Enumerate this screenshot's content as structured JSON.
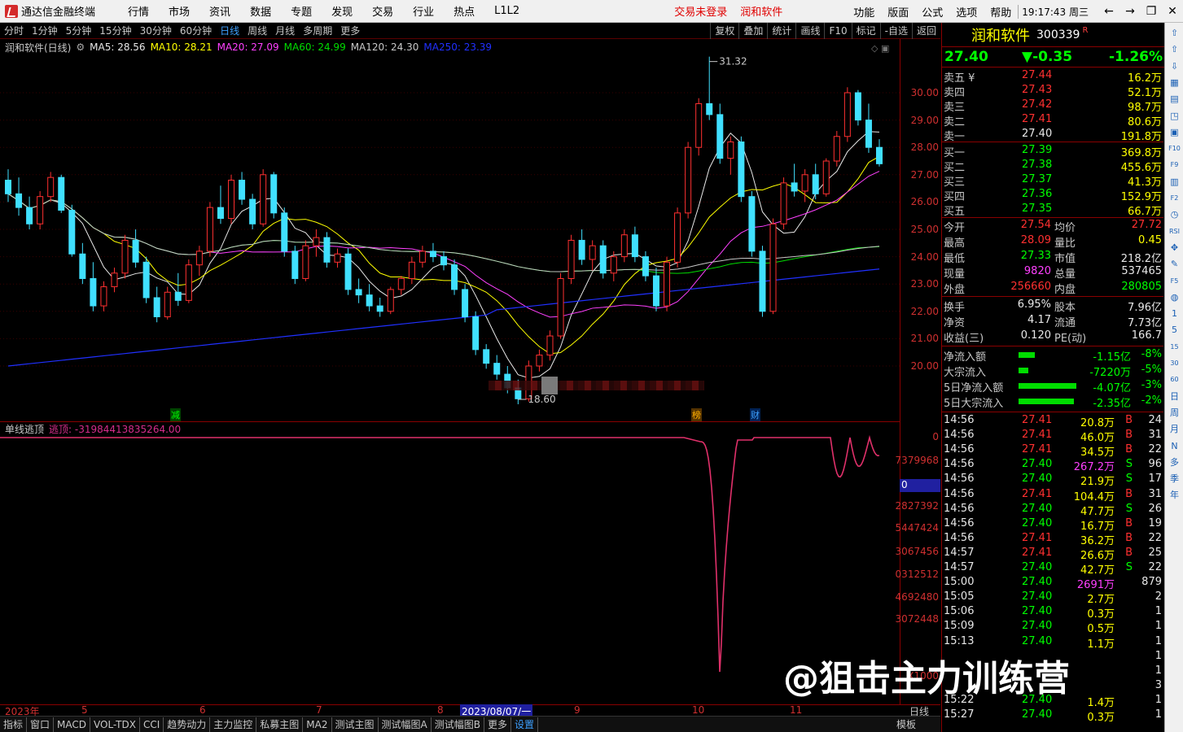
{
  "app": {
    "title": "通达信金融终端"
  },
  "menu": {
    "items": [
      "行情",
      "市场",
      "资讯",
      "数据",
      "专题",
      "发现",
      "交易",
      "行业",
      "热点",
      "L1L2"
    ],
    "login_warn": "交易未登录",
    "product": "润和软件",
    "right_items": [
      "功能",
      "版面",
      "公式",
      "选项",
      "帮助"
    ],
    "clock": "19:17:43 周三",
    "window_controls": [
      "←",
      "→",
      "❐",
      "✕"
    ]
  },
  "periods": [
    "分时",
    "1分钟",
    "5分钟",
    "15分钟",
    "30分钟",
    "60分钟",
    "日线",
    "周线",
    "月线",
    "多周期",
    "更多"
  ],
  "active_period": "日线",
  "toolbar": [
    "复权",
    "叠加",
    "统计",
    "画线",
    "F10",
    "标记",
    "-自选",
    "返回"
  ],
  "indicator": {
    "stock_label": "润和软件(日线)",
    "ma": [
      {
        "label": "MA5: 28.56",
        "color": "#e8e8e8"
      },
      {
        "label": "MA10: 28.21",
        "color": "#ffff00"
      },
      {
        "label": "MA20: 27.09",
        "color": "#ff40ff"
      },
      {
        "label": "MA60: 24.99",
        "color": "#00dd00"
      },
      {
        "label": "MA120: 24.30",
        "color": "#c8c8c8"
      },
      {
        "label": "MA250: 23.39",
        "color": "#2030ff"
      }
    ]
  },
  "main_axis": [
    "30.00",
    "29.00",
    "28.00",
    "27.00",
    "26.00",
    "25.00",
    "24.00",
    "23.00",
    "22.00",
    "21.00",
    "20.00"
  ],
  "main_annotations": {
    "high": "31.32",
    "low": "18.60"
  },
  "markers": [
    {
      "text": "减",
      "color": "#00aa00"
    },
    {
      "text": "榜",
      "color": "#e0a000"
    },
    {
      "text": "财",
      "color": "#3da0ff"
    }
  ],
  "sub_indicator": {
    "name": "单线逃顶",
    "value": "逃顶: -31984413835264.00"
  },
  "sub_axis": [
    "0",
    "7379968",
    "0",
    "2827392",
    "5447424",
    "3067456",
    "0312512",
    "4692480",
    "3072448",
    "X1000"
  ],
  "date_axis": [
    "2023年",
    "5",
    "6",
    "7",
    "8",
    "2023/08/07/一",
    "9",
    "10",
    "11",
    "日线"
  ],
  "bottom_tabs": [
    "指标",
    "窗口",
    "MACD",
    "VOL-TDX",
    "CCI",
    "趋势动力",
    "主力监控",
    "私募主图",
    "MA2",
    "测试主图",
    "测试幅图A",
    "测试幅图B",
    "更多",
    "设置"
  ],
  "active_tab": "设置",
  "template_label": "模板",
  "quote": {
    "name": "润和软件",
    "code": "300339",
    "flag": "R",
    "price": "27.40",
    "change": "▼-0.35",
    "pct": "-1.26%",
    "asks": [
      {
        "label": "卖五 ¥",
        "price": "27.44",
        "vol": "16.2万"
      },
      {
        "label": "卖四",
        "price": "27.43",
        "vol": "52.1万"
      },
      {
        "label": "卖三",
        "price": "27.42",
        "vol": "98.7万"
      },
      {
        "label": "卖二",
        "price": "27.41",
        "vol": "80.6万"
      },
      {
        "label": "卖一",
        "price": "27.40",
        "vol": "191.8万"
      }
    ],
    "bids": [
      {
        "label": "买一",
        "price": "27.39",
        "vol": "369.8万"
      },
      {
        "label": "买二",
        "price": "27.38",
        "vol": "455.6万"
      },
      {
        "label": "买三",
        "price": "27.37",
        "vol": "41.3万"
      },
      {
        "label": "买四",
        "price": "27.36",
        "vol": "152.9万"
      },
      {
        "label": "买五",
        "price": "27.35",
        "vol": "66.7万"
      }
    ],
    "stats": [
      {
        "l1": "今开",
        "v1": "27.54",
        "c1": "red",
        "l2": "均价",
        "v2": "27.72",
        "c2": "red"
      },
      {
        "l1": "最高",
        "v1": "28.09",
        "c1": "red",
        "l2": "量比",
        "v2": "0.45",
        "c2": "yellow"
      },
      {
        "l1": "最低",
        "v1": "27.33",
        "c1": "green",
        "l2": "市值",
        "v2": "218.2亿",
        "c2": "white"
      },
      {
        "l1": "现量",
        "v1": "9820",
        "c1": "mag",
        "l2": "总量",
        "v2": "537465",
        "c2": "white"
      },
      {
        "l1": "外盘",
        "v1": "256660",
        "c1": "red",
        "l2": "内盘",
        "v2": "280805",
        "c2": "green"
      }
    ],
    "stats2": [
      {
        "l1": "换手",
        "v1": "6.95%",
        "l2": "股本",
        "v2": "7.96亿"
      },
      {
        "l1": "净资",
        "v1": "4.17",
        "l2": "流通",
        "v2": "7.73亿"
      },
      {
        "l1": "收益(三)",
        "v1": "0.120",
        "l2": "PE(动)",
        "v2": "166.7"
      }
    ],
    "flows": [
      {
        "label": "净流入额",
        "value": "-1.15亿",
        "pct": "-8%",
        "bar": 0.28
      },
      {
        "label": "大宗流入",
        "value": "-7220万",
        "pct": "-5%",
        "bar": 0.16
      },
      {
        "label": "5日净流入额",
        "value": "-4.07亿",
        "pct": "-3%",
        "bar": 0.98
      },
      {
        "label": "5日大宗流入",
        "value": "-2.35亿",
        "pct": "-2%",
        "bar": 0.95
      }
    ],
    "ticks": [
      {
        "t": "14:56",
        "p": "27.41",
        "v": "20.8万",
        "d": "B",
        "n": "24",
        "vc": "white"
      },
      {
        "t": "14:56",
        "p": "27.41",
        "v": "46.0万",
        "d": "B",
        "n": "31",
        "vc": "white"
      },
      {
        "t": "14:56",
        "p": "27.41",
        "v": "34.5万",
        "d": "B",
        "n": "22",
        "vc": "white"
      },
      {
        "t": "14:56",
        "p": "27.40",
        "v": "267.2万",
        "d": "S",
        "n": "96",
        "vc": "mag"
      },
      {
        "t": "14:56",
        "p": "27.40",
        "v": "21.9万",
        "d": "S",
        "n": "17",
        "vc": "white"
      },
      {
        "t": "14:56",
        "p": "27.41",
        "v": "104.4万",
        "d": "B",
        "n": "31",
        "vc": "white"
      },
      {
        "t": "14:56",
        "p": "27.40",
        "v": "47.7万",
        "d": "S",
        "n": "26",
        "vc": "white"
      },
      {
        "t": "14:56",
        "p": "27.40",
        "v": "16.7万",
        "d": "B",
        "n": "19",
        "vc": "white"
      },
      {
        "t": "14:56",
        "p": "27.41",
        "v": "36.2万",
        "d": "B",
        "n": "22",
        "vc": "white"
      },
      {
        "t": "14:57",
        "p": "27.41",
        "v": "26.6万",
        "d": "B",
        "n": "25",
        "vc": "white"
      },
      {
        "t": "14:57",
        "p": "27.40",
        "v": "42.7万",
        "d": "S",
        "n": "22",
        "vc": "white"
      },
      {
        "t": "15:00",
        "p": "27.40",
        "v": "2691万",
        "d": "",
        "n": "879",
        "vc": "mag"
      },
      {
        "t": "15:05",
        "p": "27.40",
        "v": "2.7万",
        "d": "",
        "n": "2",
        "vc": "white"
      },
      {
        "t": "15:06",
        "p": "27.40",
        "v": "0.3万",
        "d": "",
        "n": "1",
        "vc": "white"
      },
      {
        "t": "15:09",
        "p": "27.40",
        "v": "0.5万",
        "d": "",
        "n": "1",
        "vc": "white"
      },
      {
        "t": "15:13",
        "p": "27.40",
        "v": "1.1万",
        "d": "",
        "n": "1",
        "vc": "white"
      },
      {
        "t": "",
        "p": "",
        "v": "",
        "d": "",
        "n": "1",
        "vc": "white"
      },
      {
        "t": "",
        "p": "",
        "v": "",
        "d": "",
        "n": "1",
        "vc": "white"
      },
      {
        "t": "",
        "p": "",
        "v": "",
        "d": "",
        "n": "3",
        "vc": "white"
      },
      {
        "t": "15:22",
        "p": "27.40",
        "v": "1.4万",
        "d": "",
        "n": "1",
        "vc": "white"
      },
      {
        "t": "15:27",
        "p": "27.40",
        "v": "0.3万",
        "d": "",
        "n": "1",
        "vc": "white"
      }
    ]
  },
  "sidebar_icons": [
    "⇧",
    "⇧",
    "⇩",
    "▦",
    "▤",
    "◳",
    "▣",
    "F10",
    "F9",
    "▥",
    "F2",
    "◷",
    "RSI",
    "✥",
    "✎",
    "F5",
    "◍",
    "1",
    "5",
    "15",
    "30",
    "60",
    "日",
    "周",
    "月",
    "N",
    "多",
    "季",
    "年"
  ],
  "watermark": "@狙击主力训练营",
  "chart_data": {
    "type": "candlestick",
    "note_series": [
      "MA5",
      "MA10",
      "MA20",
      "MA60",
      "MA120",
      "MA250"
    ],
    "y_range": [
      18.6,
      31.32
    ],
    "ohlc": [
      [
        26.8,
        27.2,
        26.0,
        26.3
      ],
      [
        26.3,
        26.9,
        25.5,
        25.8
      ],
      [
        25.8,
        26.2,
        25.0,
        25.2
      ],
      [
        25.2,
        26.4,
        25.0,
        26.2
      ],
      [
        26.2,
        27.1,
        26.0,
        26.9
      ],
      [
        26.9,
        27.0,
        25.6,
        25.7
      ],
      [
        25.7,
        25.9,
        24.0,
        24.1
      ],
      [
        24.1,
        24.5,
        23.0,
        23.2
      ],
      [
        23.2,
        23.8,
        22.0,
        22.2
      ],
      [
        22.2,
        23.1,
        22.0,
        22.9
      ],
      [
        22.9,
        23.6,
        22.7,
        23.4
      ],
      [
        23.4,
        24.8,
        23.2,
        24.6
      ],
      [
        24.6,
        25.0,
        23.6,
        23.8
      ],
      [
        23.8,
        24.0,
        22.3,
        22.5
      ],
      [
        22.5,
        22.9,
        21.6,
        21.8
      ],
      [
        21.8,
        22.9,
        21.7,
        22.7
      ],
      [
        22.7,
        23.4,
        22.2,
        22.4
      ],
      [
        22.4,
        23.9,
        22.3,
        23.7
      ],
      [
        23.7,
        24.4,
        23.3,
        24.2
      ],
      [
        24.2,
        26.0,
        24.0,
        25.8
      ],
      [
        25.8,
        26.6,
        25.2,
        25.4
      ],
      [
        25.4,
        27.0,
        25.2,
        26.8
      ],
      [
        26.8,
        27.1,
        25.9,
        26.1
      ],
      [
        26.1,
        26.3,
        25.0,
        25.2
      ],
      [
        25.2,
        27.2,
        25.1,
        27.0
      ],
      [
        27.0,
        27.1,
        25.4,
        25.6
      ],
      [
        25.6,
        25.8,
        24.0,
        24.2
      ],
      [
        24.2,
        24.4,
        23.0,
        23.2
      ],
      [
        23.2,
        24.6,
        23.1,
        24.4
      ],
      [
        24.4,
        25.0,
        24.0,
        24.7
      ],
      [
        24.7,
        24.9,
        23.6,
        23.8
      ],
      [
        23.8,
        24.3,
        23.6,
        24.1
      ],
      [
        24.1,
        24.3,
        22.6,
        22.8
      ],
      [
        22.8,
        23.2,
        22.3,
        22.6
      ],
      [
        22.6,
        23.0,
        22.0,
        22.2
      ],
      [
        22.2,
        22.5,
        21.8,
        22.0
      ],
      [
        22.0,
        22.9,
        21.9,
        22.8
      ],
      [
        22.8,
        23.3,
        22.6,
        23.2
      ],
      [
        23.2,
        24.0,
        23.0,
        23.8
      ],
      [
        23.8,
        24.4,
        23.6,
        24.2
      ],
      [
        24.2,
        24.5,
        23.8,
        24.0
      ],
      [
        24.0,
        24.2,
        23.5,
        23.7
      ],
      [
        23.7,
        23.9,
        22.6,
        22.8
      ],
      [
        22.8,
        23.0,
        21.6,
        21.8
      ],
      [
        21.8,
        22.0,
        20.4,
        20.6
      ],
      [
        20.6,
        20.8,
        19.9,
        20.1
      ],
      [
        20.1,
        20.4,
        19.5,
        19.7
      ],
      [
        19.7,
        20.0,
        19.0,
        19.2
      ],
      [
        19.2,
        19.5,
        18.6,
        18.8
      ],
      [
        18.8,
        20.2,
        18.7,
        20.0
      ],
      [
        20.0,
        20.6,
        19.8,
        20.4
      ],
      [
        20.4,
        21.3,
        20.2,
        21.1
      ],
      [
        21.1,
        23.4,
        21.0,
        23.2
      ],
      [
        23.2,
        24.8,
        23.0,
        24.6
      ],
      [
        24.6,
        25.0,
        23.7,
        23.9
      ],
      [
        23.9,
        24.6,
        23.5,
        24.4
      ],
      [
        24.4,
        24.6,
        23.2,
        23.4
      ],
      [
        23.4,
        24.2,
        23.1,
        24.0
      ],
      [
        24.0,
        25.0,
        23.8,
        24.8
      ],
      [
        24.8,
        25.1,
        23.8,
        24.0
      ],
      [
        24.0,
        24.2,
        23.1,
        23.3
      ],
      [
        23.3,
        23.6,
        22.0,
        22.2
      ],
      [
        22.2,
        24.0,
        22.0,
        23.8
      ],
      [
        23.8,
        25.8,
        23.6,
        25.6
      ],
      [
        25.6,
        28.2,
        25.4,
        28.0
      ],
      [
        28.0,
        29.8,
        27.7,
        29.6
      ],
      [
        29.6,
        31.32,
        29.0,
        29.2
      ],
      [
        29.2,
        29.6,
        27.4,
        27.6
      ],
      [
        27.6,
        28.4,
        27.0,
        28.2
      ],
      [
        28.2,
        28.4,
        26.0,
        26.2
      ],
      [
        26.2,
        26.4,
        24.0,
        24.2
      ],
      [
        24.2,
        24.4,
        21.8,
        22.0
      ],
      [
        22.0,
        25.4,
        21.9,
        25.2
      ],
      [
        25.2,
        26.9,
        25.0,
        26.7
      ],
      [
        26.7,
        27.4,
        26.2,
        26.4
      ],
      [
        26.4,
        27.2,
        26.0,
        27.0
      ],
      [
        27.0,
        27.4,
        26.1,
        26.3
      ],
      [
        26.3,
        27.6,
        26.2,
        27.5
      ],
      [
        27.5,
        28.6,
        27.3,
        28.4
      ],
      [
        28.4,
        30.2,
        28.2,
        30.0
      ],
      [
        30.0,
        30.1,
        28.8,
        29.0
      ],
      [
        29.0,
        29.6,
        27.8,
        28.0
      ],
      [
        28.0,
        28.3,
        27.3,
        27.4
      ]
    ],
    "sub_series": {
      "name": "逃顶",
      "shape": "mostly-zero with deep dip near Oct and small dips near Nov"
    }
  }
}
